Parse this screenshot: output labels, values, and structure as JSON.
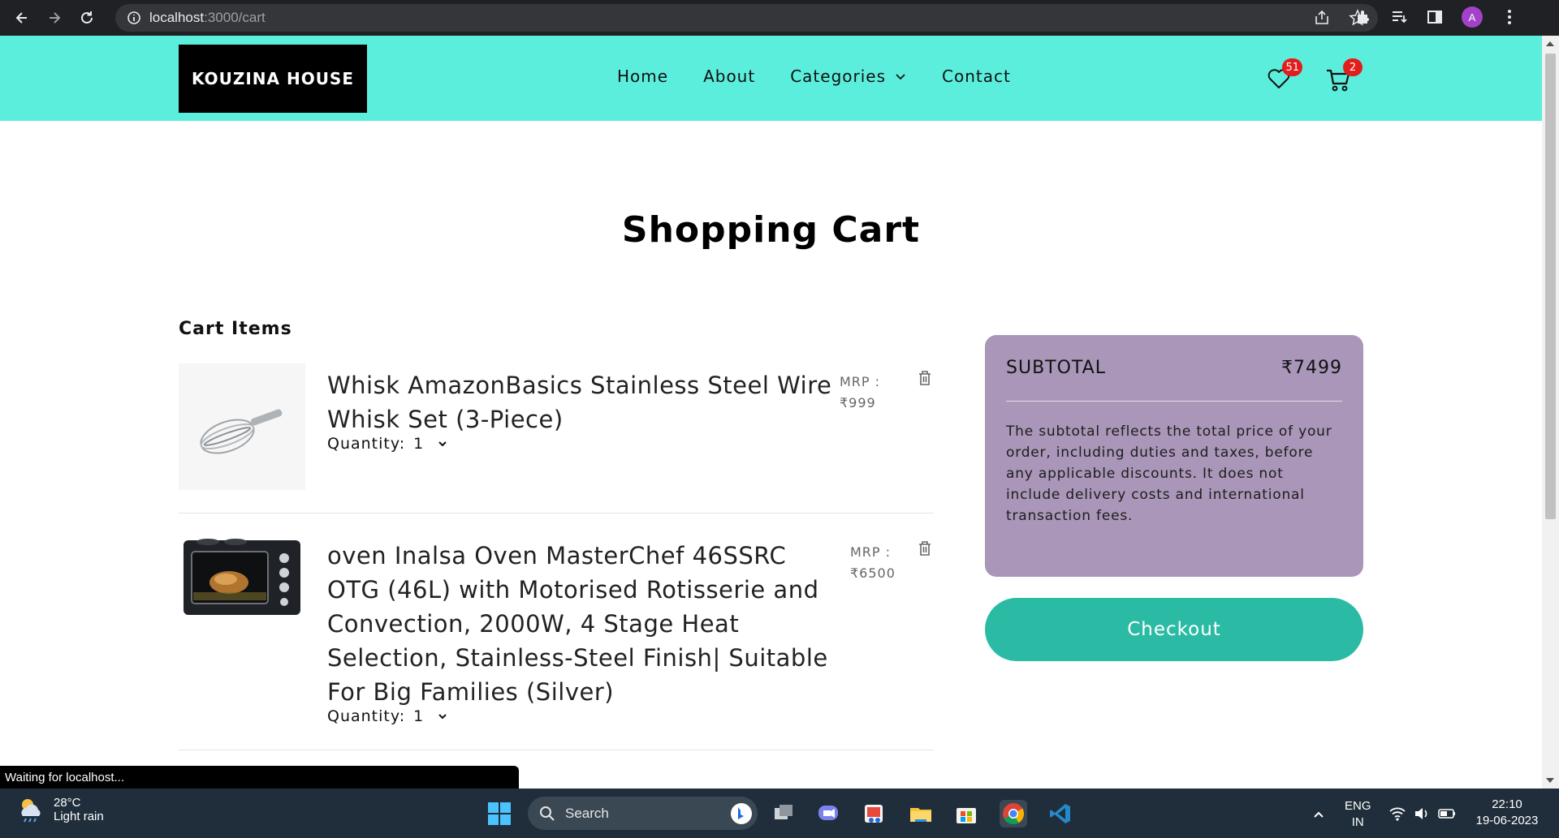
{
  "browser": {
    "url_host": "localhost",
    "url_path": ":3000/cart",
    "profile_initial": "A",
    "status_text": "Waiting for localhost..."
  },
  "site": {
    "brand": "KOUZINA HOUSE",
    "nav": [
      "Home",
      "About",
      "Categories",
      "Contact"
    ],
    "wishlist_count": "51",
    "cart_count": "2",
    "accent_color": "#5ceedd"
  },
  "page": {
    "title": "Shopping Cart",
    "section_title": "Cart Items"
  },
  "cart_items": [
    {
      "name": "Whisk AmazonBasics Stainless Steel Wire Whisk Set (3-Piece)",
      "quantity_label": "Quantity:",
      "quantity": "1",
      "mrp_label": "MRP :",
      "mrp": "₹999"
    },
    {
      "name": "oven Inalsa Oven MasterChef 46SSRC OTG (46L) with Motorised Rotisserie and Convection, 2000W, 4 Stage Heat Selection, Stainless-Steel Finish| Suitable For Big Families (Silver)",
      "quantity_label": "Quantity:",
      "quantity": "1",
      "mrp_label": "MRP :",
      "mrp": "₹6500"
    }
  ],
  "summary": {
    "label": "SUBTOTAL",
    "amount": "₹7499",
    "description": "The subtotal reflects the total price of your order, including duties and taxes, before any applicable discounts. It does not include delivery costs and international transaction fees.",
    "checkout_label": "Checkout",
    "panel_color": "#a996b8",
    "checkout_color": "#2bbba4"
  },
  "taskbar": {
    "weather_temp": "28°C",
    "weather_condition": "Light rain",
    "search_placeholder": "Search",
    "lang_top": "ENG",
    "lang_bottom": "IN",
    "time": "22:10",
    "date": "19-06-2023"
  }
}
